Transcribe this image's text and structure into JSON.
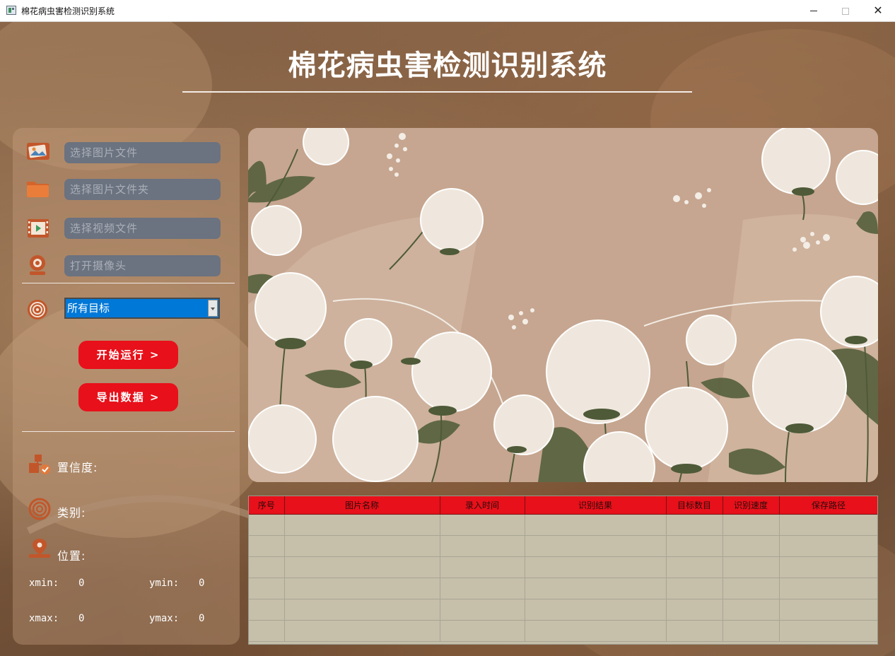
{
  "window": {
    "title": "棉花病虫害检测识别系统",
    "minimize": "",
    "maximize": "",
    "close": "✕"
  },
  "header": {
    "title": "棉花病虫害检测识别系统"
  },
  "left_panel": {
    "inputs": [
      {
        "placeholder": "选择图片文件",
        "icon": "image-file-icon"
      },
      {
        "placeholder": "选择图片文件夹",
        "icon": "folder-icon"
      },
      {
        "placeholder": "选择视频文件",
        "icon": "video-file-icon"
      },
      {
        "placeholder": "打开摄像头",
        "icon": "camera-icon"
      }
    ],
    "target_select": {
      "icon": "target-icon",
      "selected": "所有目标"
    },
    "buttons": {
      "start": "开始运行 >",
      "export": "导出数据 >"
    },
    "stats": {
      "confidence_label": "置信度:",
      "class_label": "类别:",
      "position_label": "位置:",
      "xmin_label": "xmin:",
      "xmin_value": "0",
      "ymin_label": "ymin:",
      "ymin_value": "0",
      "xmax_label": "xmax:",
      "xmax_value": "0",
      "ymax_label": "ymax:",
      "ymax_value": "0"
    }
  },
  "table": {
    "columns": [
      "序号",
      "图片名称",
      "录入时间",
      "识别结果",
      "目标数目",
      "识别速度",
      "保存路径"
    ]
  },
  "colors": {
    "accent_red": "#e8101a",
    "select_blue": "#0078d7",
    "input_gray": "#6b7280"
  }
}
